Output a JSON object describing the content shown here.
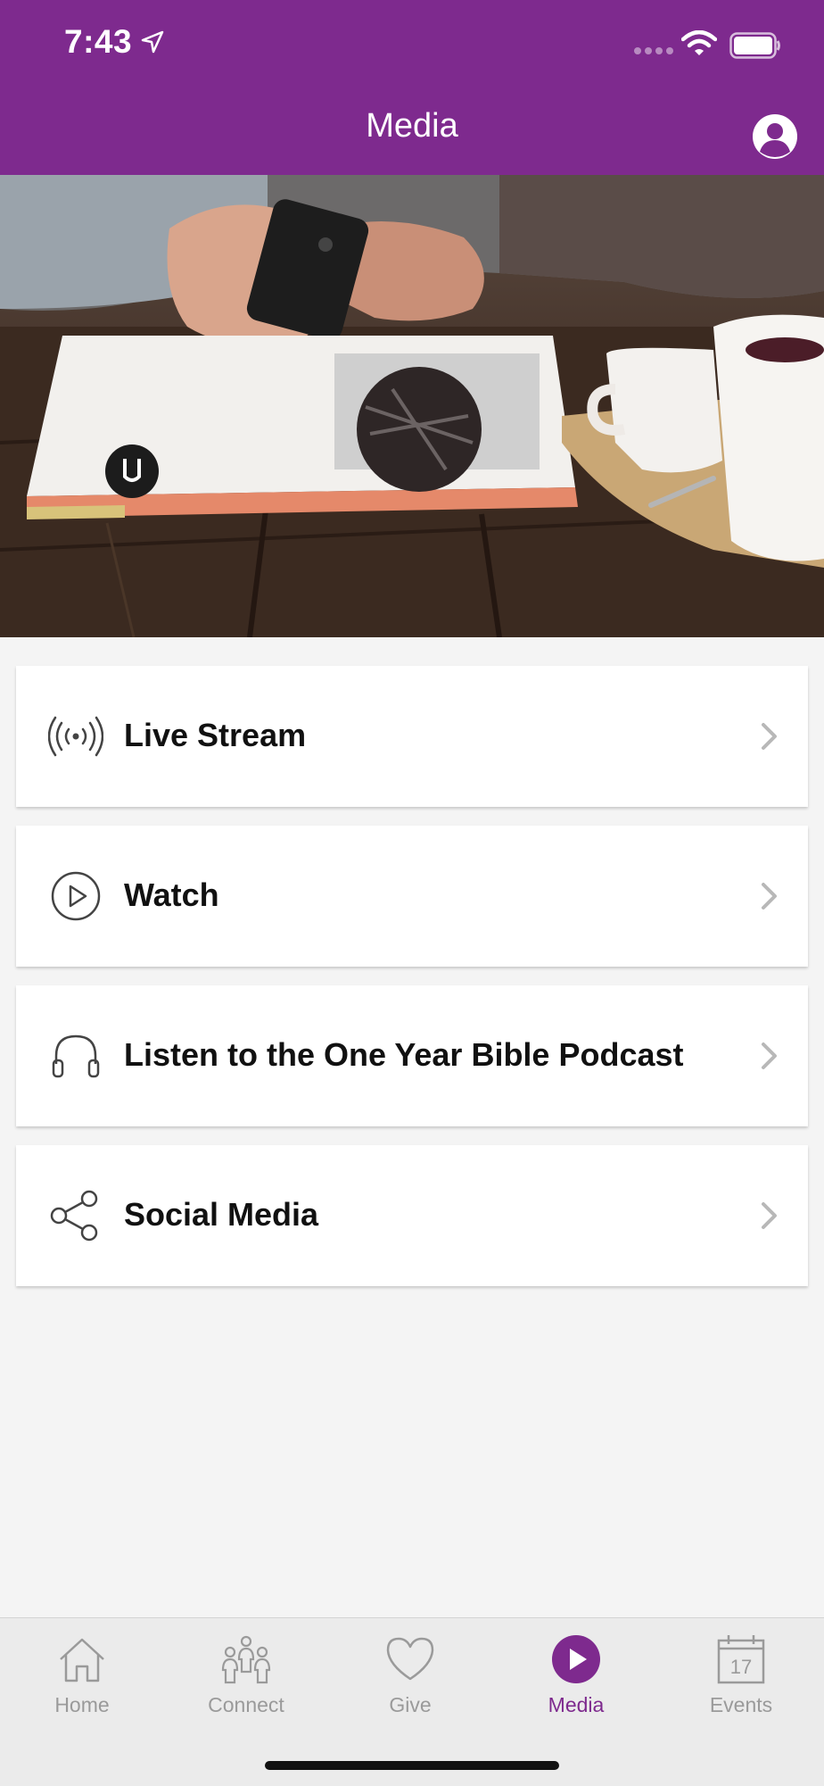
{
  "status_bar": {
    "time": "7:43"
  },
  "header": {
    "title": "Media"
  },
  "hero": {
    "image": "person holding phone over magazine with coffee cups"
  },
  "menu": [
    {
      "label": "Live Stream",
      "icon": "broadcast-icon"
    },
    {
      "label": "Watch",
      "icon": "play-circle-icon"
    },
    {
      "label": "Listen to the One Year Bible Podcast",
      "icon": "headphones-icon"
    },
    {
      "label": "Social Media",
      "icon": "share-icon"
    }
  ],
  "tabs": [
    {
      "label": "Home",
      "icon": "home-icon",
      "active": false
    },
    {
      "label": "Connect",
      "icon": "people-icon",
      "active": false
    },
    {
      "label": "Give",
      "icon": "heart-icon",
      "active": false
    },
    {
      "label": "Media",
      "icon": "play-icon",
      "active": true
    },
    {
      "label": "Events",
      "icon": "calendar-icon",
      "active": false
    }
  ],
  "calendar_day": "17",
  "colors": {
    "brand": "#7e2a8e",
    "tab_inactive": "#9a9a9a",
    "background": "#f4f4f4"
  }
}
